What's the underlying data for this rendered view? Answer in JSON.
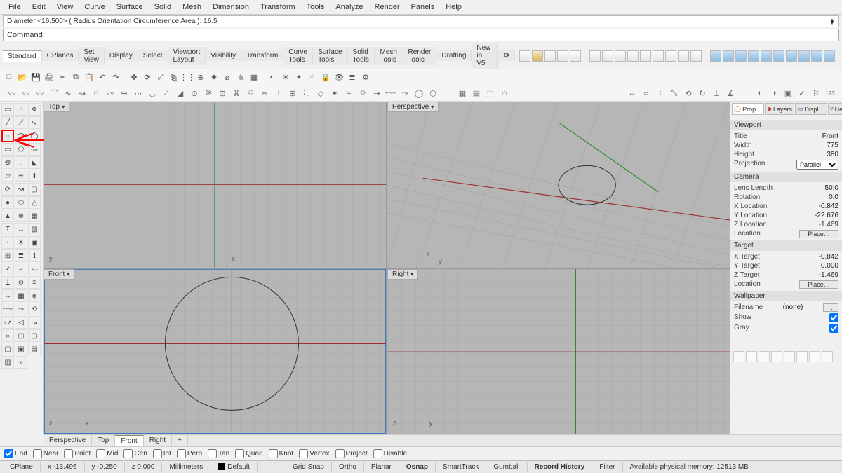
{
  "menu": [
    "File",
    "Edit",
    "View",
    "Curve",
    "Surface",
    "Solid",
    "Mesh",
    "Dimension",
    "Transform",
    "Tools",
    "Analyze",
    "Render",
    "Panels",
    "Help"
  ],
  "history_line": "Diameter <16.500> ( Radius  Orientation  Circumference  Area ): 16.5",
  "command_label": "Command:",
  "tabs": [
    "Standard",
    "CPlanes",
    "Set View",
    "Display",
    "Select",
    "Viewport Layout",
    "Visibility",
    "Transform",
    "Curve Tools",
    "Surface Tools",
    "Solid Tools",
    "Mesh Tools",
    "Render Tools",
    "Drafting",
    "New in V5"
  ],
  "viewports": {
    "top": "Top",
    "perspective": "Perspective",
    "front": "Front",
    "right": "Right"
  },
  "panel": {
    "tabs": {
      "properties": "Prop…",
      "layers": "Layers",
      "display": "Displ…",
      "help": "Help"
    },
    "sections": {
      "viewport": "Viewport",
      "camera": "Camera",
      "target": "Target",
      "wallpaper": "Wallpaper"
    },
    "viewport_props": {
      "title": {
        "k": "Title",
        "v": "Front"
      },
      "width": {
        "k": "Width",
        "v": "775"
      },
      "height": {
        "k": "Height",
        "v": "380"
      },
      "projection": {
        "k": "Projection",
        "v": "Parallel"
      }
    },
    "camera_props": {
      "lens": {
        "k": "Lens Length",
        "v": "50.0"
      },
      "rotation": {
        "k": "Rotation",
        "v": "0.0"
      },
      "xloc": {
        "k": "X Location",
        "v": "-0.842"
      },
      "yloc": {
        "k": "Y Location",
        "v": "-22.676"
      },
      "zloc": {
        "k": "Z Location",
        "v": "-1.469"
      },
      "location": {
        "k": "Location",
        "btn": "Place…"
      }
    },
    "target_props": {
      "xt": {
        "k": "X Target",
        "v": "-0.842"
      },
      "yt": {
        "k": "Y Target",
        "v": "0.000"
      },
      "zt": {
        "k": "Z Target",
        "v": "-1.469"
      },
      "location": {
        "k": "Location",
        "btn": "Place…"
      }
    },
    "wallpaper_props": {
      "filename": {
        "k": "Filename",
        "v": "(none)"
      },
      "show": {
        "k": "Show"
      },
      "gray": {
        "k": "Gray"
      }
    }
  },
  "bottom_tabs": [
    "Perspective",
    "Top",
    "Front",
    "Right",
    "+"
  ],
  "bottom_active": "Front",
  "osnap": {
    "end": "End",
    "near": "Near",
    "point": "Point",
    "mid": "Mid",
    "cen": "Cen",
    "int": "Int",
    "perp": "Perp",
    "tan": "Tan",
    "quad": "Quad",
    "knot": "Knot",
    "vertex": "Vertex",
    "project": "Project",
    "disable": "Disable"
  },
  "osnap_checked": [
    "end"
  ],
  "status": {
    "cplane": "CPlane",
    "x": "x -13.496",
    "y": "y -0.250",
    "z": "z 0.000",
    "units": "Millimeters",
    "layer": "Default",
    "gridsnap": "Grid Snap",
    "ortho": "Ortho",
    "planar": "Planar",
    "osnap": "Osnap",
    "smarttrack": "SmartTrack",
    "gumball": "Gumball",
    "recordhist": "Record History",
    "filter": "Filter",
    "mem": "Available physical memory: 12513 MB"
  }
}
